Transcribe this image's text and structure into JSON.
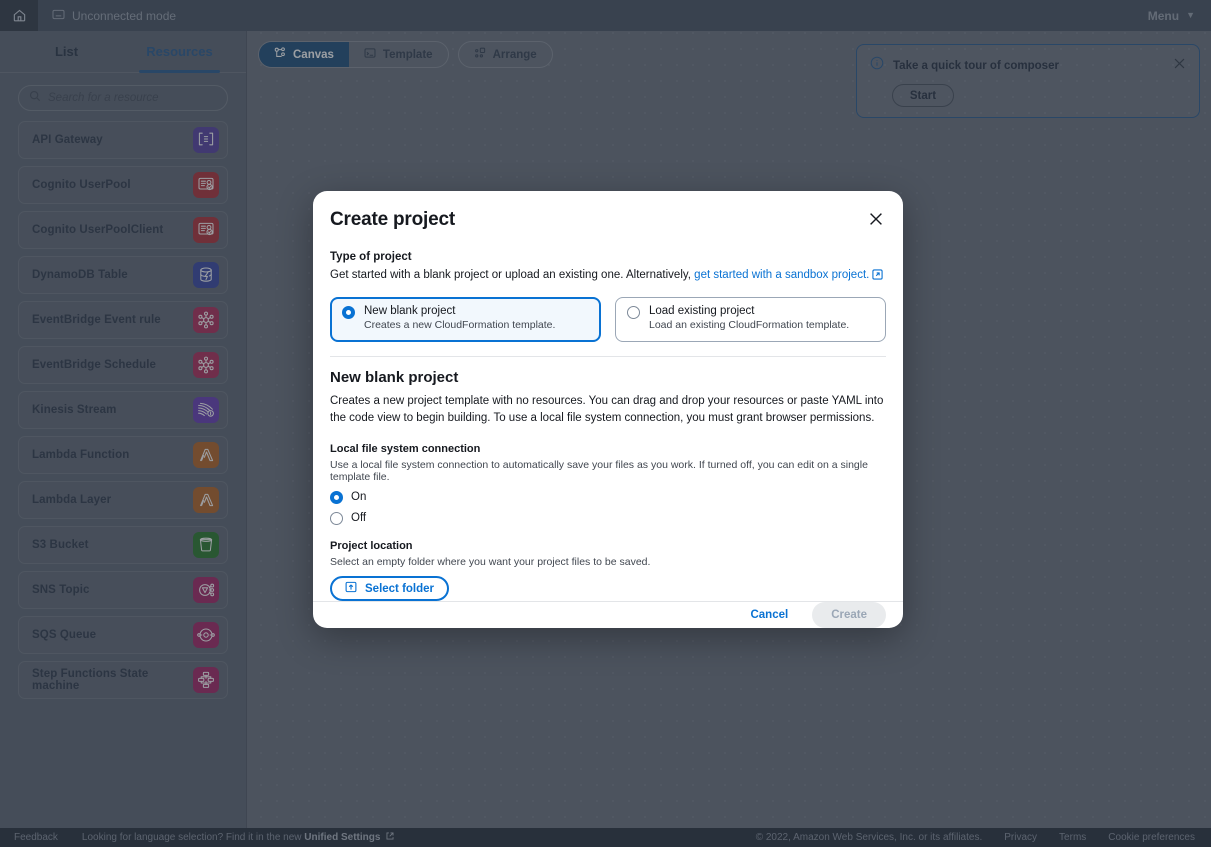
{
  "topbar": {
    "home_icon": "home-icon",
    "mode_icon": "window-icon",
    "mode_label": "Unconnected mode",
    "menu_label": "Menu",
    "menu_caret": "▼"
  },
  "sidebar": {
    "tabs": [
      {
        "label": "List",
        "active": false
      },
      {
        "label": "Resources",
        "active": true
      }
    ],
    "search": {
      "icon": "search-icon",
      "placeholder": "Search for a resource",
      "value": ""
    },
    "resources": [
      {
        "label": "API Gateway",
        "icon": "api-gateway-icon",
        "color": "#5a46a5"
      },
      {
        "label": "Cognito UserPool",
        "icon": "cognito-userpool-icon",
        "color": "#b0353f"
      },
      {
        "label": "Cognito UserPoolClient",
        "icon": "cognito-userpool-icon",
        "color": "#b0353f"
      },
      {
        "label": "DynamoDB Table",
        "icon": "dynamodb-table-icon",
        "color": "#3c4ba6"
      },
      {
        "label": "EventBridge Event rule",
        "icon": "eventbridge-icon",
        "color": "#b0325f"
      },
      {
        "label": "EventBridge Schedule",
        "icon": "eventbridge-icon",
        "color": "#b0325f"
      },
      {
        "label": "Kinesis Stream",
        "icon": "kinesis-stream-icon",
        "color": "#6a42b8"
      },
      {
        "label": "Lambda Function",
        "icon": "lambda-icon",
        "color": "#b5682c"
      },
      {
        "label": "Lambda Layer",
        "icon": "lambda-icon",
        "color": "#b5682c"
      },
      {
        "label": "S3 Bucket",
        "icon": "s3-bucket-icon",
        "color": "#2e7d32"
      },
      {
        "label": "SNS Topic",
        "icon": "sns-topic-icon",
        "color": "#a42a6a"
      },
      {
        "label": "SQS Queue",
        "icon": "sqs-queue-icon",
        "color": "#a42a6a"
      },
      {
        "label": "Step Functions State machine",
        "icon": "step-functions-icon",
        "color": "#a42a6a"
      }
    ]
  },
  "canvas": {
    "toolbar": [
      {
        "label": "Canvas",
        "icon": "canvas-icon",
        "active": true
      },
      {
        "label": "Template",
        "icon": "template-icon",
        "active": false
      },
      {
        "label": "Arrange",
        "icon": "arrange-icon",
        "active": false
      }
    ]
  },
  "tour": {
    "info_icon": "info-icon",
    "title": "Take a quick tour of composer",
    "start_label": "Start",
    "close_icon": "close-icon"
  },
  "modal": {
    "title": "Create project",
    "close_icon": "close-icon",
    "type_label": "Type of project",
    "type_desc_prefix": "Get started with a blank project or upload an existing one. Alternatively, ",
    "type_link": "get started with a sandbox project.",
    "external_icon": "external-link-icon",
    "choices": [
      {
        "title": "New blank project",
        "subtitle": "Creates a new CloudFormation template.",
        "selected": true
      },
      {
        "title": "Load existing project",
        "subtitle": "Load an existing CloudFormation template.",
        "selected": false
      }
    ],
    "section_heading": "New blank project",
    "section_paragraph": "Creates a new project template with no resources. You can drag and drop your resources or paste YAML into the code view to begin building. To use a local file system connection, you must grant browser permissions.",
    "fs_label": "Local file system connection",
    "fs_desc": "Use a local file system connection to automatically save your files as you work. If turned off, you can edit on a single template file.",
    "fs_options": [
      {
        "label": "On",
        "selected": true
      },
      {
        "label": "Off",
        "selected": false
      }
    ],
    "location_label": "Project location",
    "location_desc": "Select an empty folder where you want your project files to be saved.",
    "select_folder_label": "Select folder",
    "folder_icon": "folder-import-icon",
    "cancel_label": "Cancel",
    "create_label": "Create"
  },
  "footer": {
    "feedback": "Feedback",
    "language_prefix": "Looking for language selection? Find it in the new ",
    "language_link": "Unified Settings",
    "copyright": "© 2022, Amazon Web Services, Inc. or its affiliates.",
    "privacy": "Privacy",
    "terms": "Terms",
    "cookies": "Cookie preferences"
  },
  "colors": {
    "accent_blue": "#0972d3",
    "tab_active": "#2e5f92",
    "canvas_active": "#24537f",
    "disabled_bg": "#e9ebed"
  }
}
